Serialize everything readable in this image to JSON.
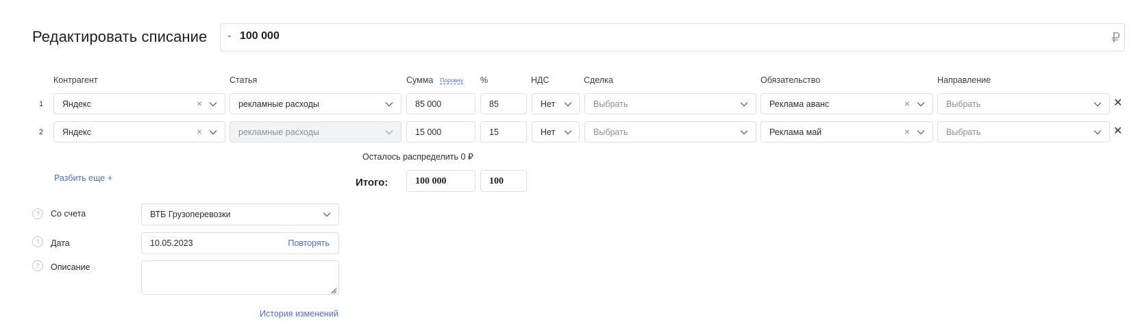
{
  "header": {
    "title": "Редактировать списание",
    "amount_sign": "-",
    "amount_value": "100 000",
    "currency": "₽"
  },
  "columns": {
    "counterparty": "Контрагент",
    "article": "Статья",
    "sum": "Сумма",
    "equal_link": "Поровну",
    "percent": "%",
    "vat": "НДС",
    "deal": "Сделка",
    "obligation": "Обязательство",
    "direction": "Направление"
  },
  "rows": [
    {
      "num": "1",
      "counterparty": "Яндекс",
      "article": "рекламные расходы",
      "sum": "85 000",
      "percent": "85",
      "vat": "Нет",
      "deal_placeholder": "Выбрать",
      "obligation": "Реклама аванс",
      "direction_placeholder": "Выбрать"
    },
    {
      "num": "2",
      "counterparty": "Яндекс",
      "article": "рекламные расходы",
      "sum": "15 000",
      "percent": "15",
      "vat": "Нет",
      "deal_placeholder": "Выбрать",
      "obligation": "Реклама май",
      "direction_placeholder": "Выбрать"
    }
  ],
  "remain_text": "Осталось распределить 0 ₽",
  "split_link": "Разбить еще +",
  "totals": {
    "label": "Итого:",
    "sum": "100 000",
    "percent": "100"
  },
  "form": {
    "account_label": "Со счета",
    "account_value": "ВТБ Грузоперевозки",
    "date_label": "Дата",
    "date_value": "10.05.2023",
    "repeat_link": "Повторять",
    "description_label": "Описание",
    "description_value": "",
    "history_link": "История изменений",
    "help_glyph": "?"
  },
  "colors": {
    "accent": "#4a6fd6",
    "border": "#dcdfe4",
    "disabled_bg": "#f2f3f5"
  }
}
